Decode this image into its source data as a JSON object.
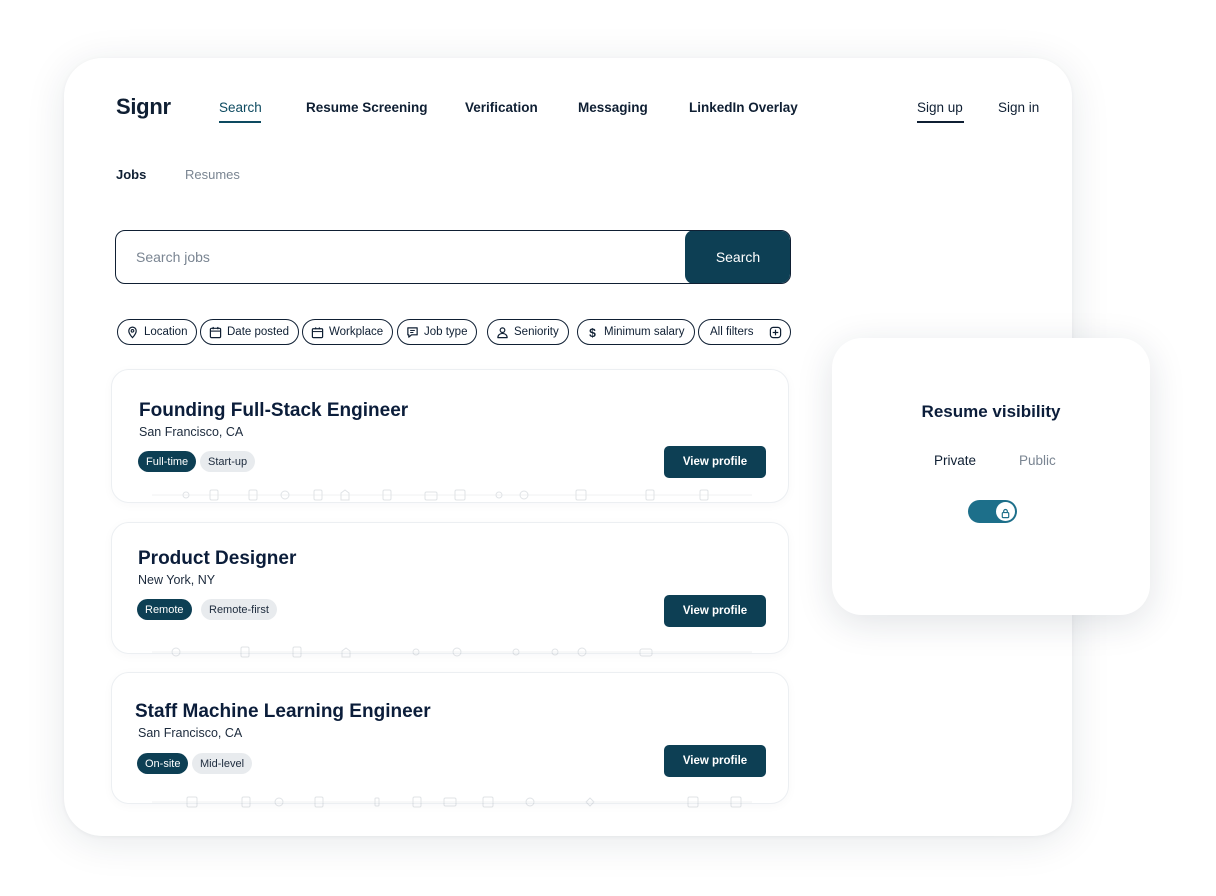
{
  "brand": {
    "logo": "Signr"
  },
  "nav": {
    "items": [
      {
        "label": "Search",
        "active": true
      },
      {
        "label": "Resume Screening",
        "active": false
      },
      {
        "label": "Verification",
        "active": false
      },
      {
        "label": "Messaging",
        "active": false
      },
      {
        "label": "LinkedIn Overlay",
        "active": false
      }
    ],
    "sign_up": "Sign up",
    "sign_in": "Sign in"
  },
  "subtabs": [
    {
      "label": "Jobs",
      "active": true
    },
    {
      "label": "Resumes",
      "active": false
    }
  ],
  "search": {
    "placeholder": "Search jobs",
    "value": "",
    "button": "Search"
  },
  "filters": [
    {
      "label": "Location",
      "icon": "location-pin-icon"
    },
    {
      "label": "Date posted",
      "icon": "calendar-icon"
    },
    {
      "label": "Workplace",
      "icon": "building-icon"
    },
    {
      "label": "Job type",
      "icon": "chat-list-icon"
    },
    {
      "label": "Seniority",
      "icon": "person-icon"
    },
    {
      "label": "Minimum salary",
      "icon": "dollar-icon"
    },
    {
      "label": "All filters",
      "icon": "filter-plus-icon"
    }
  ],
  "jobs": [
    {
      "title": "Founding Full-Stack Engineer",
      "location": "San Francisco, CA",
      "tags": [
        "Full-time",
        "Start-up"
      ],
      "button": "View profile"
    },
    {
      "title": "Product Designer",
      "location": "New York, NY",
      "tags": [
        "Remote",
        "Remote-first"
      ],
      "button": "View profile"
    },
    {
      "title": "Staff Machine Learning Engineer",
      "location": "San Francisco, CA",
      "tags": [
        "On-site",
        "Mid-level"
      ],
      "button": "View profile"
    }
  ],
  "visibility": {
    "title": "Resume visibility",
    "option_private": "Private",
    "option_public": "Public",
    "selected": "Private"
  },
  "colors": {
    "primary": "#0d3f54",
    "accent": "#0d4a60",
    "toggle": "#1d6f8a",
    "text": "#0f1f33",
    "muted": "#7a8592"
  }
}
